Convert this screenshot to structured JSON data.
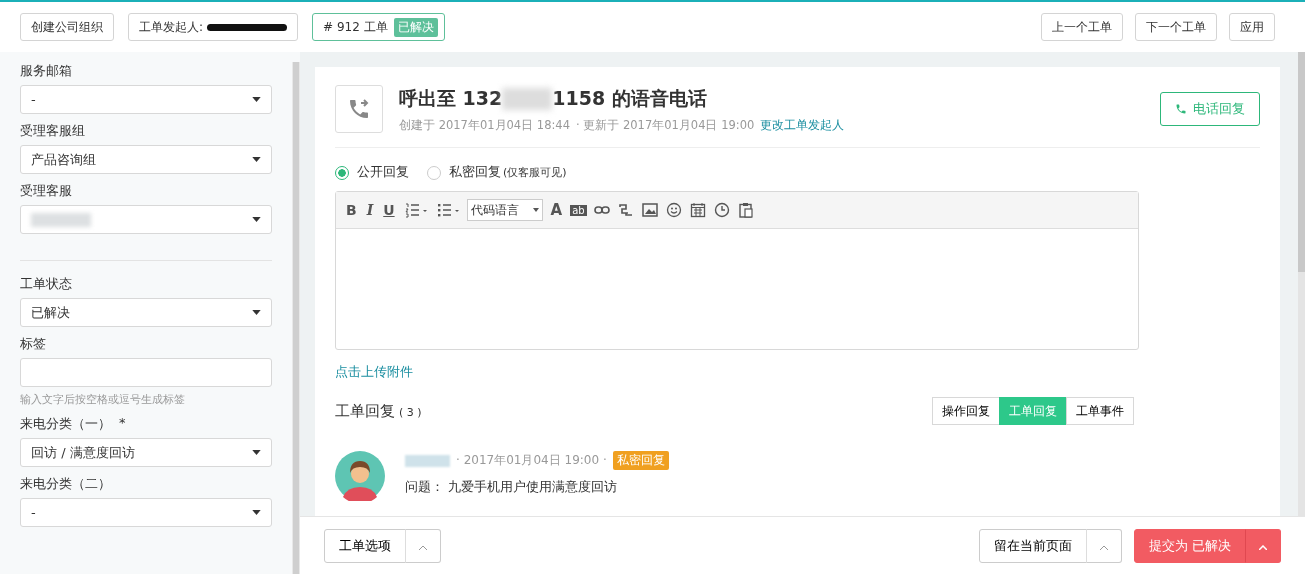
{
  "topbar": {
    "left_buttons": [
      {
        "label": "创建公司组织"
      },
      {
        "label": "工单发起人:"
      }
    ],
    "ticket": {
      "number": "# 912 工单",
      "status": "已解决"
    },
    "right_buttons": [
      {
        "label": "上一个工单"
      },
      {
        "label": "下一个工单"
      },
      {
        "label": "应用"
      }
    ]
  },
  "sidebar": {
    "groups": [
      [
        {
          "kind": "select",
          "label": "服务邮箱",
          "value": "-"
        },
        {
          "kind": "select",
          "label": "受理客服组",
          "value": "产品咨询组"
        },
        {
          "kind": "select-redacted",
          "label": "受理客服"
        }
      ],
      [
        {
          "kind": "select",
          "label": "工单状态",
          "value": "已解决"
        },
        {
          "kind": "input",
          "label": "标签",
          "help": "输入文字后按空格或逗号生成标签"
        },
        {
          "kind": "select",
          "label": "来电分类（一）",
          "required": "*",
          "value": "回访 / 满意度回访"
        },
        {
          "kind": "select",
          "label": "来电分类（二）",
          "value": "-"
        }
      ]
    ]
  },
  "ticket": {
    "title_before": "呼出至 132",
    "title_after": "1158 的语音电话",
    "created": "创建于 2017年01月04日 18:44",
    "updated": "· 更新于 2017年01月04日 19:00",
    "change_link": "更改工单发起人",
    "call_button": "电话回复"
  },
  "reply_type": [
    {
      "label": "公开回复",
      "selected": true
    },
    {
      "label": "私密回复",
      "note": "(仅客服可见)",
      "selected": false
    }
  ],
  "toolbar": [
    {
      "kind": "bold",
      "label": "B"
    },
    {
      "kind": "italic",
      "label": "I"
    },
    {
      "kind": "underline",
      "label": "U"
    },
    {
      "kind": "ordered-list"
    },
    {
      "kind": "bullet-list"
    },
    {
      "kind": "select",
      "label": "代码语言"
    },
    {
      "kind": "font-color",
      "label": "A"
    },
    {
      "kind": "highlight",
      "label": "ab"
    },
    {
      "kind": "link"
    },
    {
      "kind": "unlink"
    },
    {
      "kind": "image"
    },
    {
      "kind": "emoji"
    },
    {
      "kind": "calendar"
    },
    {
      "kind": "clock"
    },
    {
      "kind": "paste"
    }
  ],
  "upload_link": "点击上传附件",
  "replies_section": {
    "title": "工单回复",
    "count": "( 3 )",
    "tabs": [
      {
        "label": "操作回复",
        "selected": false
      },
      {
        "label": "工单回复",
        "selected": true
      },
      {
        "label": "工单事件",
        "selected": false
      }
    ],
    "items": [
      {
        "time": "· 2017年01月04日 19:00 ·",
        "badge": "私密回复",
        "text": "问题： 九爱手机用户使用满意度回访"
      }
    ]
  },
  "footer": {
    "options": "工单选项",
    "stay": "留在当前页面",
    "submit": "提交为 已解决"
  }
}
